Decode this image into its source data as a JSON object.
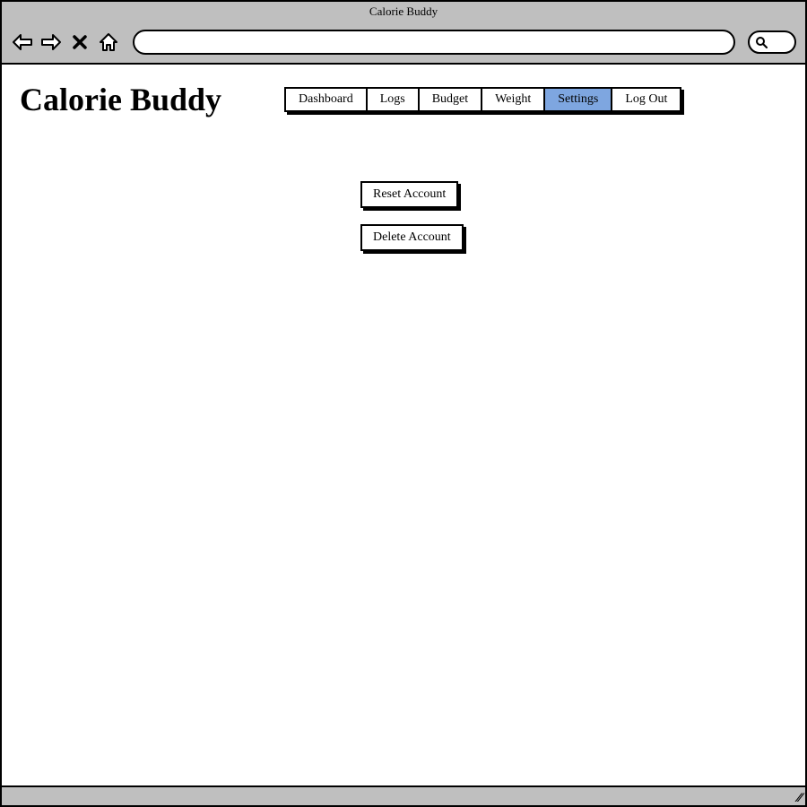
{
  "window": {
    "title": "Calorie Buddy"
  },
  "app": {
    "title": "Calorie Buddy"
  },
  "tabs": [
    {
      "label": "Dashboard",
      "active": false
    },
    {
      "label": "Logs",
      "active": false
    },
    {
      "label": "Budget",
      "active": false
    },
    {
      "label": "Weight",
      "active": false
    },
    {
      "label": "Settings",
      "active": true
    },
    {
      "label": "Log Out",
      "active": false
    }
  ],
  "settings": {
    "reset_label": "Reset Account",
    "delete_label": "Delete Account"
  }
}
